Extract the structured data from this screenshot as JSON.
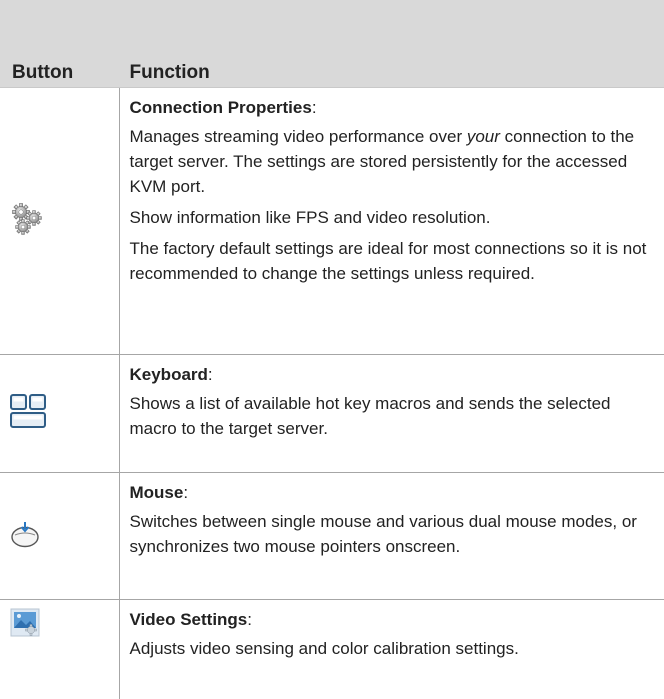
{
  "table": {
    "headers": {
      "button": "Button",
      "function": "Function"
    },
    "rows": [
      {
        "icon": "connection-properties-gears-icon",
        "title": "Connection Properties",
        "colon": ":",
        "paragraphs": [
          {
            "pre": "Manages streaming video performance over ",
            "em": "your",
            "post": " connection to the target server. The settings are stored persistently for the accessed KVM port."
          },
          {
            "text": "Show information like FPS and video resolution."
          },
          {
            "text": "The factory default settings are ideal for most connections so it is not recommended to change the settings unless required."
          }
        ]
      },
      {
        "icon": "keyboard-icon",
        "title": "Keyboard",
        "colon": ":",
        "paragraphs": [
          {
            "text": "Shows a list of available hot key macros and sends the selected macro to the target server."
          }
        ]
      },
      {
        "icon": "mouse-icon",
        "title": "Mouse",
        "colon": ":",
        "paragraphs": [
          {
            "text": "Switches between single mouse and various dual mouse modes, or synchronizes two mouse pointers onscreen."
          }
        ]
      },
      {
        "icon": "video-settings-icon",
        "title": "Video Settings",
        "colon": ":",
        "paragraphs": [
          {
            "text": "Adjusts video sensing and color calibration settings."
          }
        ]
      }
    ]
  }
}
